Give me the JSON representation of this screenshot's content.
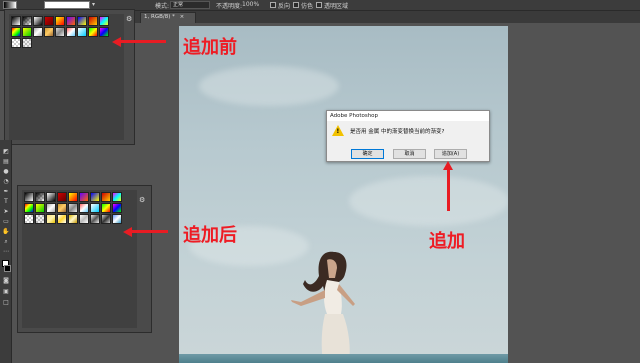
{
  "options_bar": {
    "mode_label": "模式:",
    "mode_value": "正常",
    "opacity_label": "不透明度:",
    "opacity_value": "100%",
    "reverse_label": "反向",
    "dither_label": "仿色",
    "transparency_label": "透明区域"
  },
  "document_tab": {
    "title": "1, RGB/8) *",
    "close": "×"
  },
  "annotations": {
    "before": "追加前",
    "after": "追加后",
    "append": "追加"
  },
  "dialog": {
    "title": "Adobe Photoshop",
    "message": "是否用 金属 中的渐变替换当前的渐变?",
    "ok_label": "确定",
    "cancel_label": "取消",
    "append_label": "追加(A)"
  },
  "icons": {
    "settings": "gear-icon",
    "warning": "warning-icon"
  },
  "colors": {
    "annotation_red": "#ee1c24",
    "panel_bg": "#404040",
    "ui_bg": "#535353"
  }
}
